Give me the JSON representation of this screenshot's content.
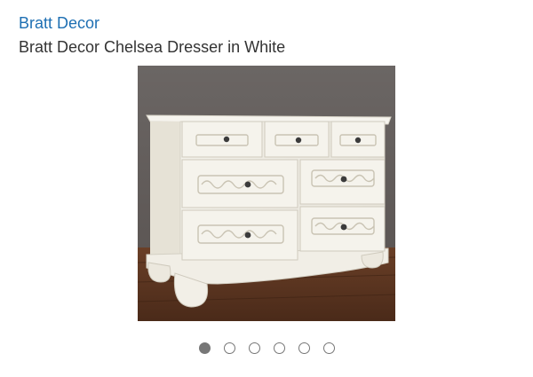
{
  "product": {
    "brand": "Bratt Decor",
    "title": "Bratt Decor Chelsea Dresser in White",
    "image_icon": "dresser-photo"
  },
  "carousel": {
    "total": 6,
    "active_index": 0
  },
  "colors": {
    "brand_link": "#1e6fb3",
    "title_text": "#333333",
    "dot": "#777777"
  }
}
